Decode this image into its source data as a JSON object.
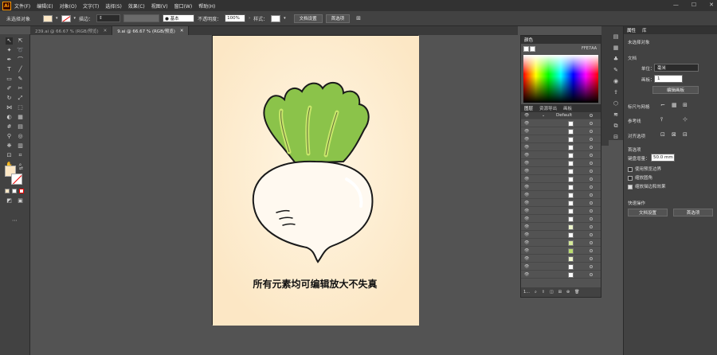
{
  "menubar": {
    "logo": "Ai",
    "items": [
      "文件(F)",
      "编辑(E)",
      "对象(O)",
      "文字(T)",
      "选择(S)",
      "效果(C)",
      "视图(V)",
      "窗口(W)",
      "帮助(H)"
    ],
    "window_controls": [
      "—",
      "☐",
      "✕"
    ]
  },
  "controlbar": {
    "selection_label": "未选择对象",
    "stroke_label": "描边：",
    "brush_label": "● 基本",
    "opacity_label": "不透明度：",
    "opacity_value": "100%",
    "style_label": "样式：",
    "doc_setup": "文档设置",
    "preferences": "首选项"
  },
  "tabs": [
    {
      "label": "239.ai @ 66.67 % (RGB/预览)",
      "close": "✕"
    },
    {
      "label": "9.ai @ 66.67 % (RGB/预览)",
      "close": "✕"
    }
  ],
  "canvas": {
    "caption": "所有元素均可编辑放大不失真",
    "artboard_color": "#FCE7C5"
  },
  "color_panel": {
    "title": "颜色",
    "hex": "FFE7AA"
  },
  "layers_panel": {
    "tabs": [
      "图层",
      "资源导出",
      "画板"
    ],
    "layer_name": "Default",
    "footer_count": "1..."
  },
  "properties": {
    "tabs": [
      "属性",
      "库"
    ],
    "no_selection": "未选择对象",
    "document_title": "文档",
    "units_label": "单位：",
    "units_value": "毫米",
    "artboard_label": "画板：",
    "artboard_value": "1",
    "edit_artboards": "编辑画板",
    "rulers_grid": "标尺与网格",
    "guides": "参考线",
    "snap_options": "对齐选项",
    "preferences_title": "首选项",
    "keyboard_inc_label": "键盘增量：",
    "keyboard_inc_value": "50.0 mm",
    "use_preview_bounds": "使用预览边界",
    "scale_corners": "缩放圆角",
    "scale_strokes": "缩放描边和效果",
    "quick_actions": "快速操作",
    "doc_setup_btn": "文档设置",
    "prefs_btn": "首选项"
  }
}
